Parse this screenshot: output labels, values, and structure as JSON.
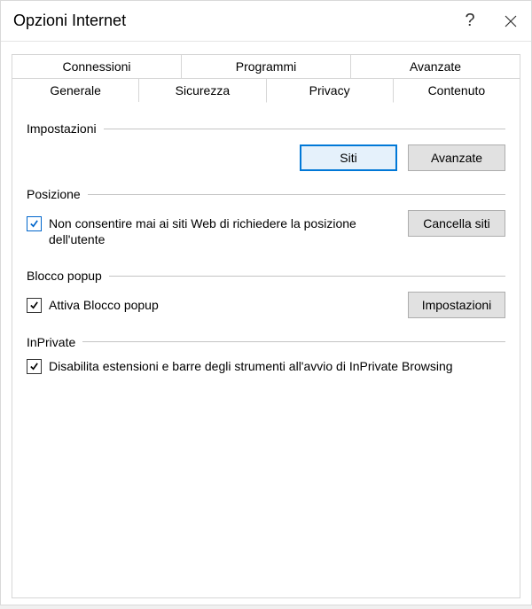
{
  "window": {
    "title": "Opzioni Internet"
  },
  "tabs": {
    "top": [
      {
        "label": "Connessioni"
      },
      {
        "label": "Programmi"
      },
      {
        "label": "Avanzate"
      }
    ],
    "bottom": [
      {
        "label": "Generale"
      },
      {
        "label": "Sicurezza"
      },
      {
        "label": "Privacy",
        "active": true
      },
      {
        "label": "Contenuto"
      }
    ]
  },
  "settings_group": {
    "title": "Impostazioni",
    "sites_button": "Siti",
    "advanced_button": "Avanzate"
  },
  "location_group": {
    "title": "Posizione",
    "never_allow_label": "Non consentire mai ai siti Web di richiedere la posizione dell'utente",
    "never_allow_checked": true,
    "clear_sites_button": "Cancella siti"
  },
  "popup_group": {
    "title": "Blocco popup",
    "enable_label": "Attiva Blocco popup",
    "enable_checked": true,
    "settings_button": "Impostazioni"
  },
  "inprivate_group": {
    "title": "InPrivate",
    "disable_ext_label": "Disabilita estensioni e barre degli strumenti all'avvio di InPrivate Browsing",
    "disable_ext_checked": true
  }
}
